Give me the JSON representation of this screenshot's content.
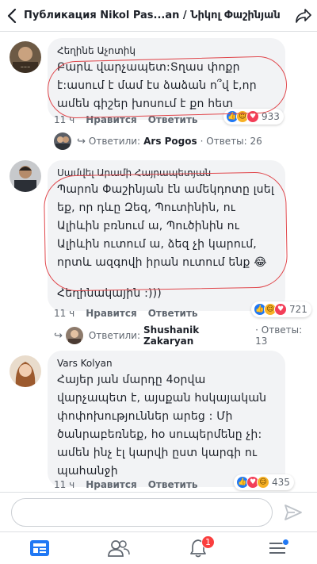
{
  "header": {
    "title": "Публикация Nikol Pas...an / Նիկոլ Փաշինյան"
  },
  "comments": [
    {
      "author": "Հեղինե Աչոտիկ",
      "text": "Բարև վարչապետ:Տղաս փոքր է:ասում է մամ էս ձաձան ո՞վ է,որ ամեն գիշեր խոսում է քո հետ",
      "time": "11 ч",
      "like_label": "Нравится",
      "reply_label": "Ответить",
      "reaction_count": "933",
      "replies": {
        "prefix": "Ответили:",
        "name": "Ars Pogos",
        "count": "· Ответы: 26"
      }
    },
    {
      "author": "Սամվել Արամի Հայրապետյան",
      "text": "Պարոն Փաշինյան էն ամեկդոտը լսել եք, որ դևը Զեզ, Պուտինին, ու Ալիևին բռնում ա, Պուծինին ու Ալիևին ուտում ա, ձեզ չի կարում, որտև ազգովի իրան ուտում ենք 😂",
      "signature": "Հեղինակային :)))",
      "time": "11 ч",
      "like_label": "Нравится",
      "reply_label": "Ответить",
      "reaction_count": "721",
      "replies": {
        "prefix": "Ответили:",
        "name": "Shushanik Zakaryan",
        "count": "· Ответы: 13"
      }
    },
    {
      "author": "Vars Kolyan",
      "text": "Հայեր յան մարդը 4օրվա վարչապետ է, այսքան հսկայական փոփոխություններ արեց : Մի ծանրաբեռնեք, հօ սուպերմենը չի: ամեն ինչ էլ կարվի ըստ կարգի ու պահանջի",
      "time": "11 ч",
      "like_label": "Нравится",
      "reply_label": "Ответить",
      "reaction_count": "435"
    }
  ],
  "composer": {
    "placeholder": ""
  },
  "tabbar": {
    "notifications_badge": "1"
  },
  "colors": {
    "facebook_blue": "#2078f4",
    "bubble_gray": "#f2f3f5",
    "annotation_red": "#e0474c",
    "badge_red": "#fa3e3e"
  },
  "icons": {
    "back": "back-chevron-icon",
    "share": "share-icon",
    "send": "send-icon",
    "tabs": [
      "news-feed-icon",
      "friends-icon",
      "notifications-bell-icon",
      "menu-icon"
    ]
  }
}
